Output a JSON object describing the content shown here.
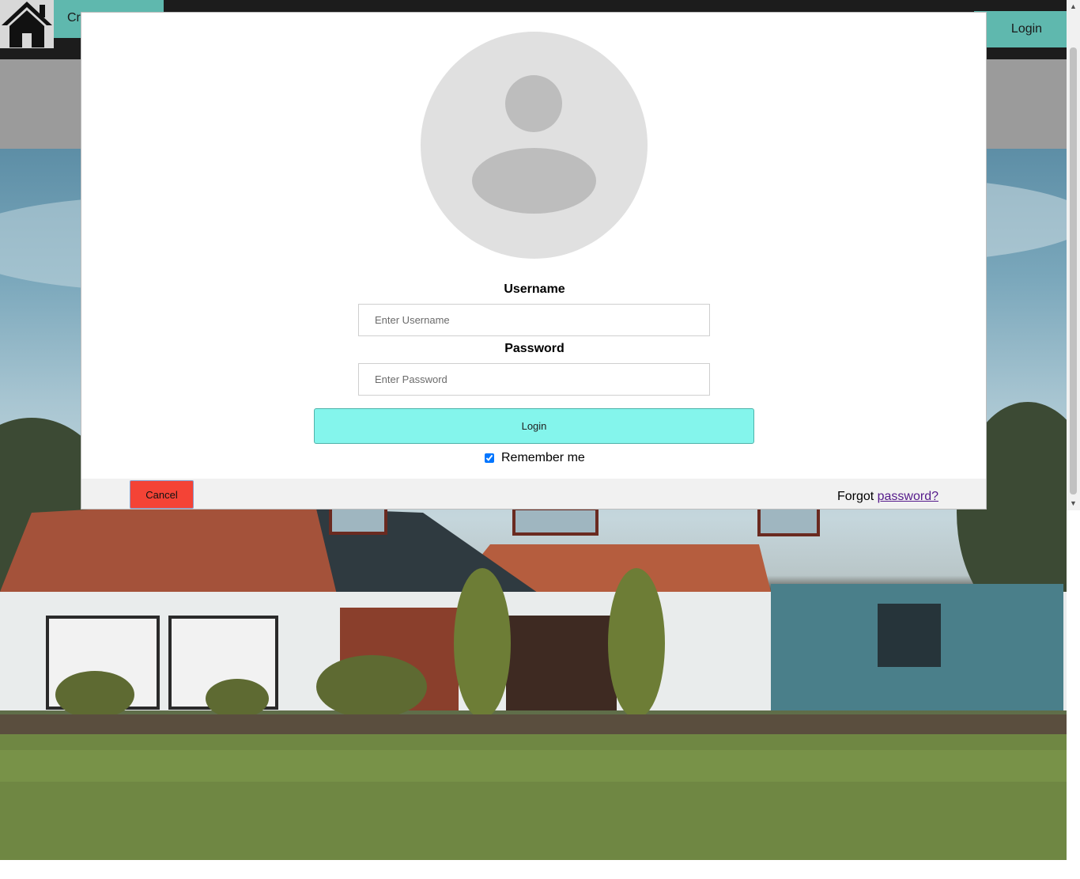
{
  "nav": {
    "create_label": "Create",
    "login_label": "Login"
  },
  "modal": {
    "username_label": "Username",
    "username_placeholder": "Enter Username",
    "password_label": "Password",
    "password_placeholder": "Enter Password",
    "login_button": "Login",
    "remember_label": "Remember me",
    "remember_checked": true,
    "cancel_button": "Cancel",
    "forgot_prefix": "Forgot ",
    "forgot_link": "password?"
  },
  "icons": {
    "home": "house-icon",
    "avatar": "user-avatar-icon",
    "scroll_up": "scroll-up-arrow-icon",
    "scroll_down": "scroll-down-arrow-icon"
  },
  "colors": {
    "nav_accent": "#5fb8ae",
    "login_button_bg": "#84f5ec",
    "cancel_button_bg": "#f44336",
    "link": "#551a8b"
  }
}
